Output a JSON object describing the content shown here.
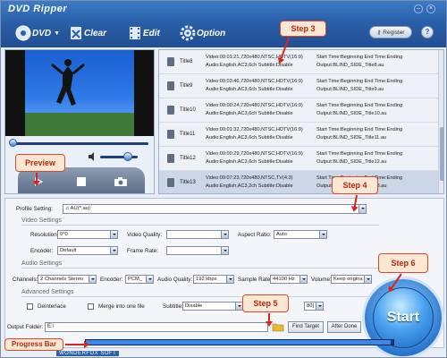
{
  "app": {
    "title": "DVD Ripper"
  },
  "toolbar": {
    "dvd": "DVD",
    "clear": "Clear",
    "edit": "Edit",
    "option": "Option",
    "register": "Register",
    "help": "?"
  },
  "file_list": {
    "rows": [
      {
        "title": "Title8",
        "info1": "Video:00:01:21,720x480,NTSC,HDTV(16:9)",
        "info2": "Audio:English,AC3,6ch Subtitle:Disable",
        "out1": "Start Time:Beginning End Time:Ending",
        "out2": "Output:BLIND_SIDE_Title8.au"
      },
      {
        "title": "Title9",
        "info1": "Video:00:03:46,720x480,NTSC,HDTV(16:9)",
        "info2": "Audio:English,AC3,6ch Subtitle:Disable",
        "out1": "Start Time:Beginning End Time:Ending",
        "out2": "Output:BLIND_SIDE_Title9.au"
      },
      {
        "title": "Title10",
        "info1": "Video:00:00:24,720x480,NTSC,HDTV(16:9)",
        "info2": "Audio:English,AC3,6ch Subtitle:Disable",
        "out1": "Start Time:Beginning End Time:Ending",
        "out2": "Output:BLIND_SIDE_Title10.au"
      },
      {
        "title": "Title11",
        "info1": "Video:00:01:32,720x480,NTSC,HDTV(16:9)",
        "info2": "Audio:English,AC3,6ch Subtitle:Disable",
        "out1": "Start Time:Beginning End Time:Ending",
        "out2": "Output:BLIND_SIDE_Title11.au"
      },
      {
        "title": "Title12",
        "info1": "Video:00:00:29,720x480,NTSC,HDTV(16:9)",
        "info2": "Audio:English,AC3,6ch Subtitle:Disable",
        "out1": "Start Time:Beginning End Time:Ending",
        "out2": "Output:BLIND_SIDE_Title12.au"
      },
      {
        "title": "Title13",
        "info1": "Video:00:07:23,720x480,NTSC,TV(4:3)",
        "info2": "Audio:English,AC3,2ch Subtitle:Disable",
        "out1": "Start Time:Beginning End Time:Ending",
        "out2": "Output:BLIND_SIDE_Title13.au"
      }
    ]
  },
  "profile": {
    "label": "Profile Setting:",
    "value": "AU(*.au)"
  },
  "video_settings": {
    "section": "Video Settings",
    "resolution_label": "Resolution:",
    "resolution": "0*0",
    "quality_label": "Video Quality:",
    "quality": "",
    "aspect_label": "Aspect Ratio:",
    "aspect": "Auto",
    "encoder_label": "Encoder:",
    "encoder": "Default",
    "framerate_label": "Frame Rate:",
    "framerate": ""
  },
  "audio_settings": {
    "section": "Audio Settings",
    "channels_label": "Channels:",
    "channels": "2 Channels Stereo",
    "encoder_label": "Encoder:",
    "encoder": "PCM_",
    "quality_label": "Audio Quality:",
    "quality": "192 kbps",
    "samplerate_label": "Sample Rate:",
    "samplerate": "44100 Hz",
    "volume_label": "Volume:",
    "volume": "Keep origina"
  },
  "advanced_settings": {
    "section": "Advanced Settings",
    "deinterlace": "Deinterlace",
    "merge": "Merge into one file",
    "subtitle_label": "Subtitle:",
    "subtitle": "Disable",
    "extra_value": "80]"
  },
  "output": {
    "label": "Output Folder:",
    "value": "E:\\",
    "find_target": "Find Target",
    "after_done": "After Done"
  },
  "start": {
    "label": "Start"
  },
  "progress": {
    "fraction": 0.99
  },
  "footer": {
    "logo": "WONDERFOX SOFT"
  },
  "callouts": {
    "step3": "Step 3",
    "step4": "Step 4",
    "step5": "Step 5",
    "step6": "Step 6",
    "preview": "Preview",
    "progress_bar": "Progress Bar"
  },
  "colors": {
    "header": "#2a5fa9",
    "callout_red": "#d8261f",
    "callout_fill": "#fde6d2"
  }
}
